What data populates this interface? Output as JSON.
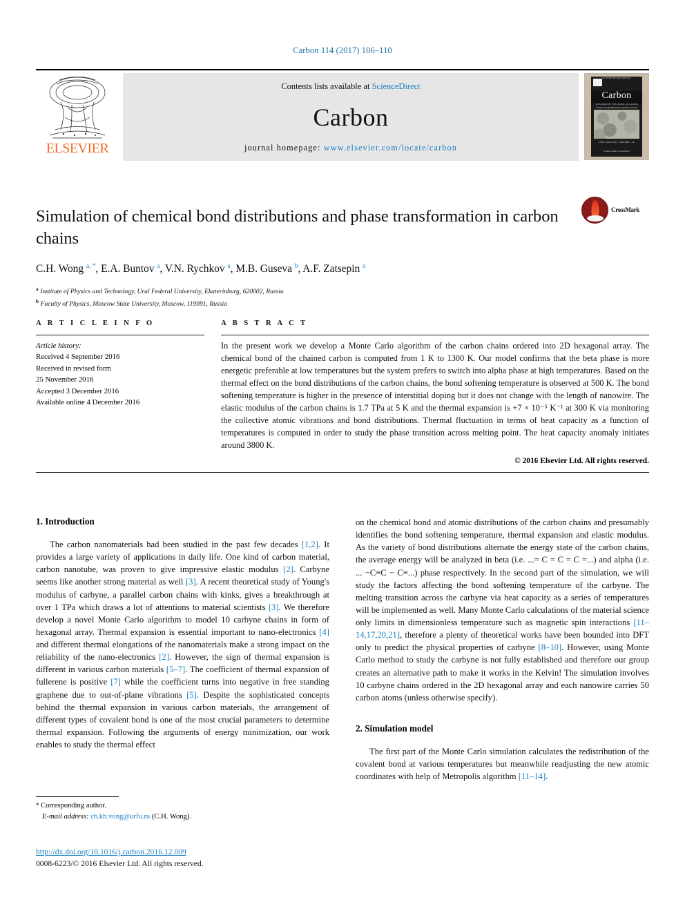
{
  "running_head": "Carbon 114 (2017) 106–110",
  "masthead": {
    "contents_prefix": "Contents lists available at ",
    "sciencedirect": "ScienceDirect",
    "journal_title": "Carbon",
    "homepage_prefix": "journal homepage: ",
    "homepage_url": "www.elsevier.com/locate/carbon",
    "publisher_wordmark": "ELSEVIER",
    "cover": {
      "title": "Carbon",
      "top_micro": "AN INTERNATIONAL JOURNAL",
      "kicker": "An International Journal",
      "subtitle": "SPONSORED BY THE AMERICAN CARBON SOCIETY, THE BRITISH CARBON GROUP AND THE CARBON SOCIETY OF JAPAN",
      "volume_line": "ISSN 0008-6223   VOLUME 114",
      "footer": "Available online at\nScienceDirect"
    }
  },
  "article": {
    "title": "Simulation of chemical bond distributions and phase transformation in carbon chains",
    "crossmark_label": "CrossMark",
    "authors_html": "C.H. Wong <sup>a, *</sup>, E.A. Buntov <sup>a</sup>, V.N. Rychkov <sup>a</sup>, M.B. Guseva <sup>b</sup>, A.F. Zatsepin <sup>a</sup>",
    "affiliations": [
      {
        "marker": "a",
        "text": "Institute of Physics and Technology, Ural Federal University, Ekaterinburg, 620002, Russia"
      },
      {
        "marker": "b",
        "text": "Faculty of Physics, Moscow State University, Moscow, 119991, Russia"
      }
    ]
  },
  "article_info": {
    "heading": "A R T I C L E  I N F O",
    "history_label": "Article history:",
    "history": [
      "Received 4 September 2016",
      "Received in revised form",
      "25 November 2016",
      "Accepted 3 December 2016",
      "Available online 4 December 2016"
    ]
  },
  "abstract": {
    "heading": "A B S T R A C T",
    "text": "In the present work we develop a Monte Carlo algorithm of the carbon chains ordered into 2D hexagonal array. The chemical bond of the chained carbon is computed from 1 K to 1300 K. Our model confirms that the beta phase is more energetic preferable at low temperatures but the system prefers to switch into alpha phase at high temperatures. Based on the thermal effect on the bond distributions of the carbon chains, the bond softening temperature is observed at 500 K. The bond softening temperature is higher in the presence of interstitial doping but it does not change with the length of nanowire. The elastic modulus of the carbon chains is 1.7 TPa at 5 K and the thermal expansion is +7 × 10⁻⁵ K⁻¹ at 300 K via monitoring the collective atomic vibrations and bond distributions. Thermal fluctuation in terms of heat capacity as a function of temperatures is computed in order to study the phase transition across melting point. The heat capacity anomaly initiates around 3800 K.",
    "copyright": "© 2016 Elsevier Ltd. All rights reserved."
  },
  "sections": {
    "introduction_heading": "1. Introduction",
    "simulation_heading": "2. Simulation model",
    "intro_p1_html": "The carbon nanomaterials had been studied in the past few decades <span class=\"ref\">[1,2]</span>. It provides a large variety of applications in daily life. One kind of carbon material, carbon nanotube, was proven to give impressive elastic modulus <span class=\"ref\">[2]</span>. Carbyne seems like another strong material as well <span class=\"ref\">[3]</span>. A recent theoretical study of Young's modulus of carbyne, a parallel carbon chains with kinks, gives a breakthrough at over 1 TPa which draws a lot of attentions to material scientists <span class=\"ref\">[3]</span>. We therefore develop a novel Monte Carlo algorithm to model 10 carbyne chains in form of hexagonal array. Thermal expansion is essential important to nano-electronics <span class=\"ref\">[4]</span> and different thermal elongations of the nanomaterials make a strong impact on the reliability of the nano-electronics <span class=\"ref\">[2]</span>. However, the sign of thermal expansion is different in various carbon materials <span class=\"ref\">[5–7]</span>. The coefficient of thermal expansion of fullerene is positive <span class=\"ref\">[7]</span> while the coefficient turns into negative in free standing graphene due to out-of-plane vibrations <span class=\"ref\">[5]</span>. Despite the sophisticated concepts behind the thermal expansion in various carbon materials, the arrangement of different types of covalent bond is one of the most crucial parameters to determine thermal expansion. Following the arguments of energy minimization, our work enables to study the thermal effect",
    "intro_p1_cont_html": "on the chemical bond and atomic distributions of the carbon chains and presumably identifies the bond softening temperature, thermal expansion and elastic modulus. As the variety of bond distributions alternate the energy state of the carbon chains, the average energy will be analyzed in beta (i.e. ...= C = C = C =...) and alpha (i.e. ... −C≡C − C≡...) phase respectively. In the second part of the simulation, we will study the factors affecting the bond softening temperature of the carbyne. The melting transition across the carbyne via heat capacity as a series of temperatures will be implemented as well. Many Monte Carlo calculations of the material science only limits in dimensionless temperature such as magnetic spin interactions <span class=\"ref\">[11–14,17,20,21]</span>, therefore a plenty of theoretical works have been bounded into DFT only to predict the physical properties of carbyne <span class=\"ref\">[8–10]</span>. However, using Monte Carlo method to study the carbyne is not fully established and therefore our group creates an alternative path to make it works in the Kelvin! The simulation involves 10 carbyne chains ordered in the 2D hexagonal array and each nanowire carries 50 carbon atoms (unless otherwise specify).",
    "sim_p1_html": "The first part of the Monte Carlo simulation calculates the redistribution of the covalent bond at various temperatures but meanwhile readjusting the new atomic coordinates with help of Metropolis algorithm <span class=\"ref\">[11–14]</span>."
  },
  "footnote": {
    "corresponding": "Corresponding author.",
    "email_label": "E-mail address:",
    "email": "ch.kh.vong@urfu.ru",
    "email_suffix": "(C.H. Wong)."
  },
  "imprint": {
    "doi": "http://dx.doi.org/10.1016/j.carbon.2016.12.009",
    "issn_line": "0008-6223/© 2016 Elsevier Ltd. All rights reserved."
  },
  "colors": {
    "link_blue": "#1a7ec2",
    "elsevier_orange": "#f26522",
    "banner_gray": "#e6e6e6"
  }
}
